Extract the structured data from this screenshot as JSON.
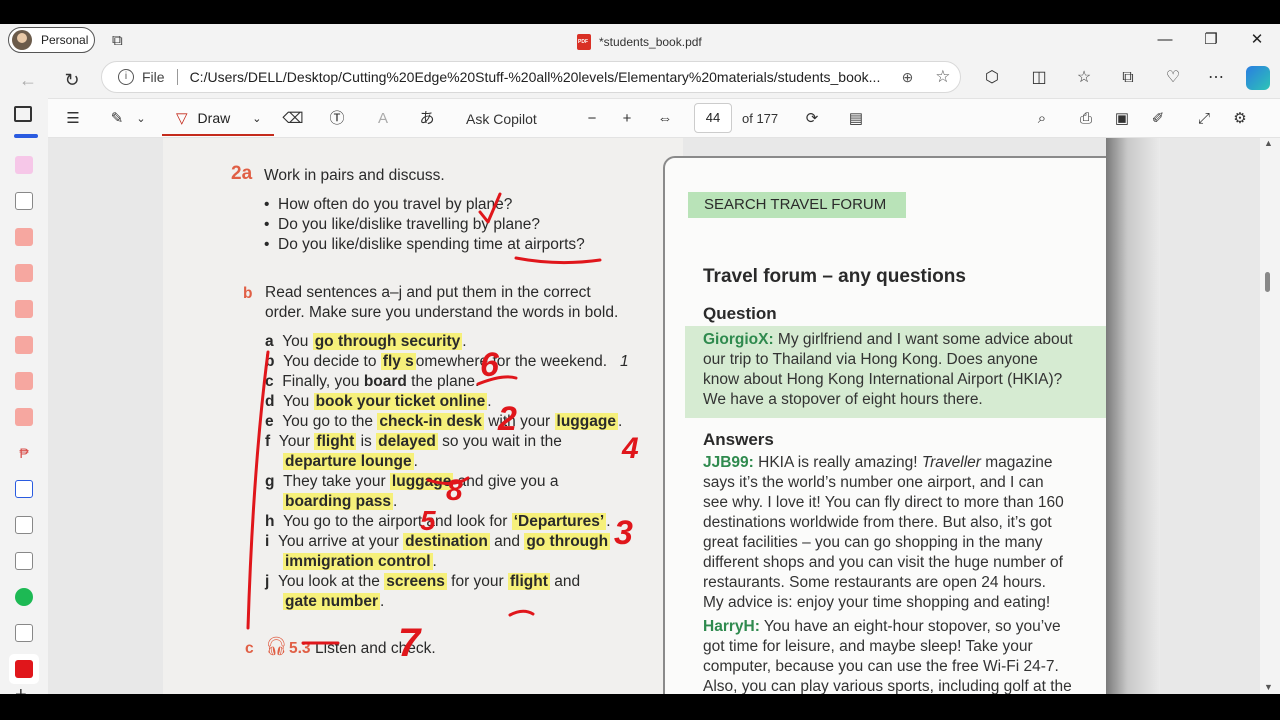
{
  "window": {
    "profile_label": "Personal",
    "title": "*students_book.pdf",
    "controls": {
      "minimize": "—",
      "maximize": "❐",
      "close": "✕"
    }
  },
  "addressbar": {
    "file_label": "File",
    "url": "C:/Users/DELL/Desktop/Cutting%20Edge%20Stuff-%20all%20levels/Elementary%20materials/students_book...."
  },
  "pdf_toolbar": {
    "draw_label": "Draw",
    "ask_copilot": "Ask Copilot",
    "page_current": "44",
    "page_total": "of 177"
  },
  "left_page": {
    "ex2a_label": "2a",
    "ex2a_title": "Work in pairs and discuss.",
    "questions": [
      "How often do you travel by plane?",
      "Do you like/dislike travelling by plane?",
      "Do you like/dislike spending time at airports?"
    ],
    "ex2b_label": "b",
    "ex2b_line1": "Read sentences a–j and put them in the correct",
    "ex2b_line2": "order. Make sure you understand the words in bold.",
    "sentences": {
      "a": {
        "letter": "a",
        "pre": "You ",
        "bold": "go through security",
        "post": "."
      },
      "b": {
        "letter": "b",
        "pre": "You decide to ",
        "bold": "fly s",
        "post": "omewhere for the weekend.",
        "num": "1"
      },
      "c": {
        "letter": "c",
        "pre": "Finally, you ",
        "bold": "board",
        "post": " the plane."
      },
      "d": {
        "letter": "d",
        "pre": "You ",
        "bold": "book your ticket online",
        "post": "."
      },
      "e": {
        "letter": "e",
        "pre": "You go to the ",
        "bold": "check-in desk",
        "mid": " with your ",
        "bold2": "luggage",
        "post": "."
      },
      "f": {
        "letter": "f",
        "pre": "Your ",
        "bold": "flight",
        "mid": " is ",
        "bold2": "delayed",
        "post": " so you wait in the",
        "line2": "departure lounge",
        "line2post": "."
      },
      "g": {
        "letter": "g",
        "pre": "They take your ",
        "bold": "luggage",
        "post": " and give you a",
        "line2": "boarding pass",
        "line2post": "."
      },
      "h": {
        "letter": "h",
        "pre": "You go to the airport and look for ",
        "bold": "‘Departures’",
        "post": "."
      },
      "i": {
        "letter": "i",
        "pre": "You arrive at your ",
        "bold": "destination",
        "mid": " and ",
        "bold2": "go through",
        "line2": "immigration control",
        "line2post": "."
      },
      "j": {
        "letter": "j",
        "pre": "You look at the ",
        "bold": "screens",
        "mid": " for your ",
        "bold2": "flight",
        "post": " and",
        "line2": "gate number",
        "line2post": "."
      }
    },
    "ex2c_label": "c",
    "ex2c_track": "5.3",
    "ex2c_text": "Listen and check.",
    "handwritten_numbers": [
      "6",
      "2",
      "4",
      "8",
      "5",
      "3",
      "7"
    ]
  },
  "right_page": {
    "search_label": "SEARCH TRAVEL FORUM",
    "heading": "Travel forum – any questions",
    "question_label": "Question",
    "question_user": "GiorgioX:",
    "question_lines": [
      " My girlfriend and I want some advice about",
      "our trip to Thailand via Hong Kong. Does anyone",
      "know about Hong Kong International Airport (HKIA)?",
      "We have a stopover of eight hours there."
    ],
    "answers_label": "Answers",
    "answer1_user": "JJB99:",
    "answer1_lines": [
      " HKIA is really amazing! ",
      "says it’s the world’s number one airport, and I can",
      "see why. I love it! You can fly direct to more than 160",
      "destinations worldwide from there. But also, it’s got",
      "great facilities – you can go shopping in the many",
      "different shops and you can visit the huge number of",
      "restaurants. Some restaurants are open 24 hours.",
      "My advice is: enjoy your time shopping and eating!"
    ],
    "answer1_italic": "Traveller",
    "answer1_tail": " magazine",
    "answer2_user": "HarryH:",
    "answer2_lines": [
      " You have an eight-hour stopover, so you’ve",
      "got time for leisure, and maybe sleep! Take your",
      "computer, because you can use the free Wi-Fi 24-7.",
      "Also, you can play various sports, including golf at the"
    ]
  },
  "colors": {
    "ink": "#e0161b",
    "highlight": "#f6f07a",
    "forum_green": "#2f8a4e",
    "accent": "#c42b1c"
  }
}
